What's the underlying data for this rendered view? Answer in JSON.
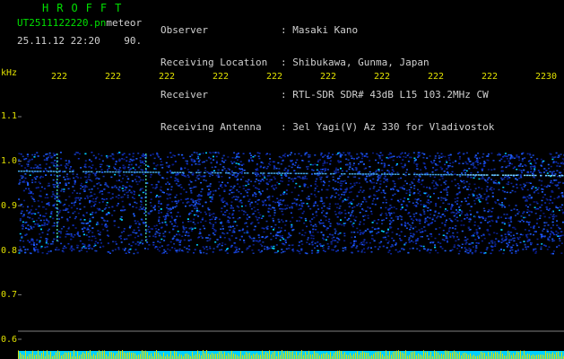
{
  "header": {
    "title": "HROFFT",
    "file_name": "UT2511122220.pn",
    "file_suffix": "meteor",
    "date_time": "25.11.12 22:20",
    "count": "90."
  },
  "station_info": [
    {
      "label": "Observer",
      "value": ": Masaki Kano"
    },
    {
      "label": "Receiving Location",
      "value": ": Shibukawa, Gunma, Japan"
    },
    {
      "label": "Receiver",
      "value": ": RTL-SDR SDR# 43dB L15 103.2MHz CW"
    },
    {
      "label": "Receiving Antenna",
      "value": ": 3el Yagi(V) Az 330 for Vladivostok"
    }
  ],
  "y_axis": {
    "unit": "kHz",
    "ticks": [
      "1.1",
      "1.0",
      "0.9",
      "0.8",
      "0.7",
      "0.6"
    ]
  },
  "x_axis": {
    "ticks": [
      "222",
      "222",
      "222",
      "222",
      "222",
      "222",
      "222",
      "222",
      "222",
      "2230"
    ]
  },
  "colors": {
    "text": "#d0d0d0",
    "accent_green": "#00e000",
    "axis_yellow": "#e0e000",
    "signal_blue": "#1030c0",
    "signal_cyan": "#00d0ff",
    "tick_gray": "#808080"
  }
}
